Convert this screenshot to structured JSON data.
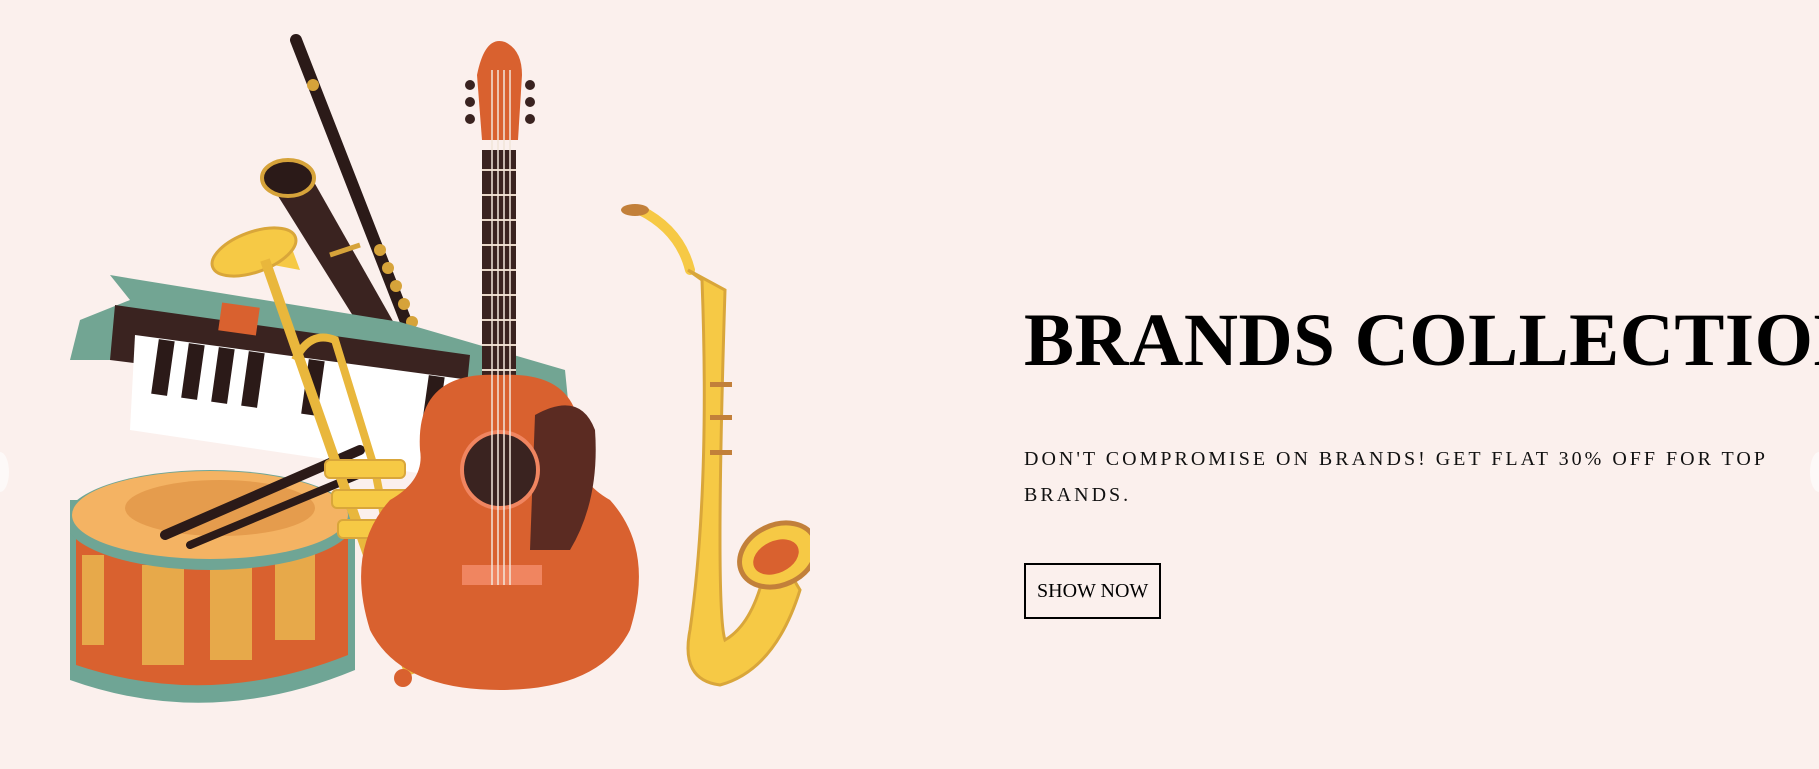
{
  "hero": {
    "title": "BRANDS COLLECTION",
    "subtitle": "DON'T COMPROMISE ON BRANDS! GET FLAT 30% OFF FOR TOP BRANDS.",
    "button_label": "SHOW NOW",
    "image_icon": "musical-instruments-illustration"
  },
  "colors": {
    "background": "#fbf0ed",
    "accent_orange": "#d9612f",
    "accent_teal": "#6fa595",
    "accent_gold": "#f3c545",
    "text": "#000000"
  }
}
